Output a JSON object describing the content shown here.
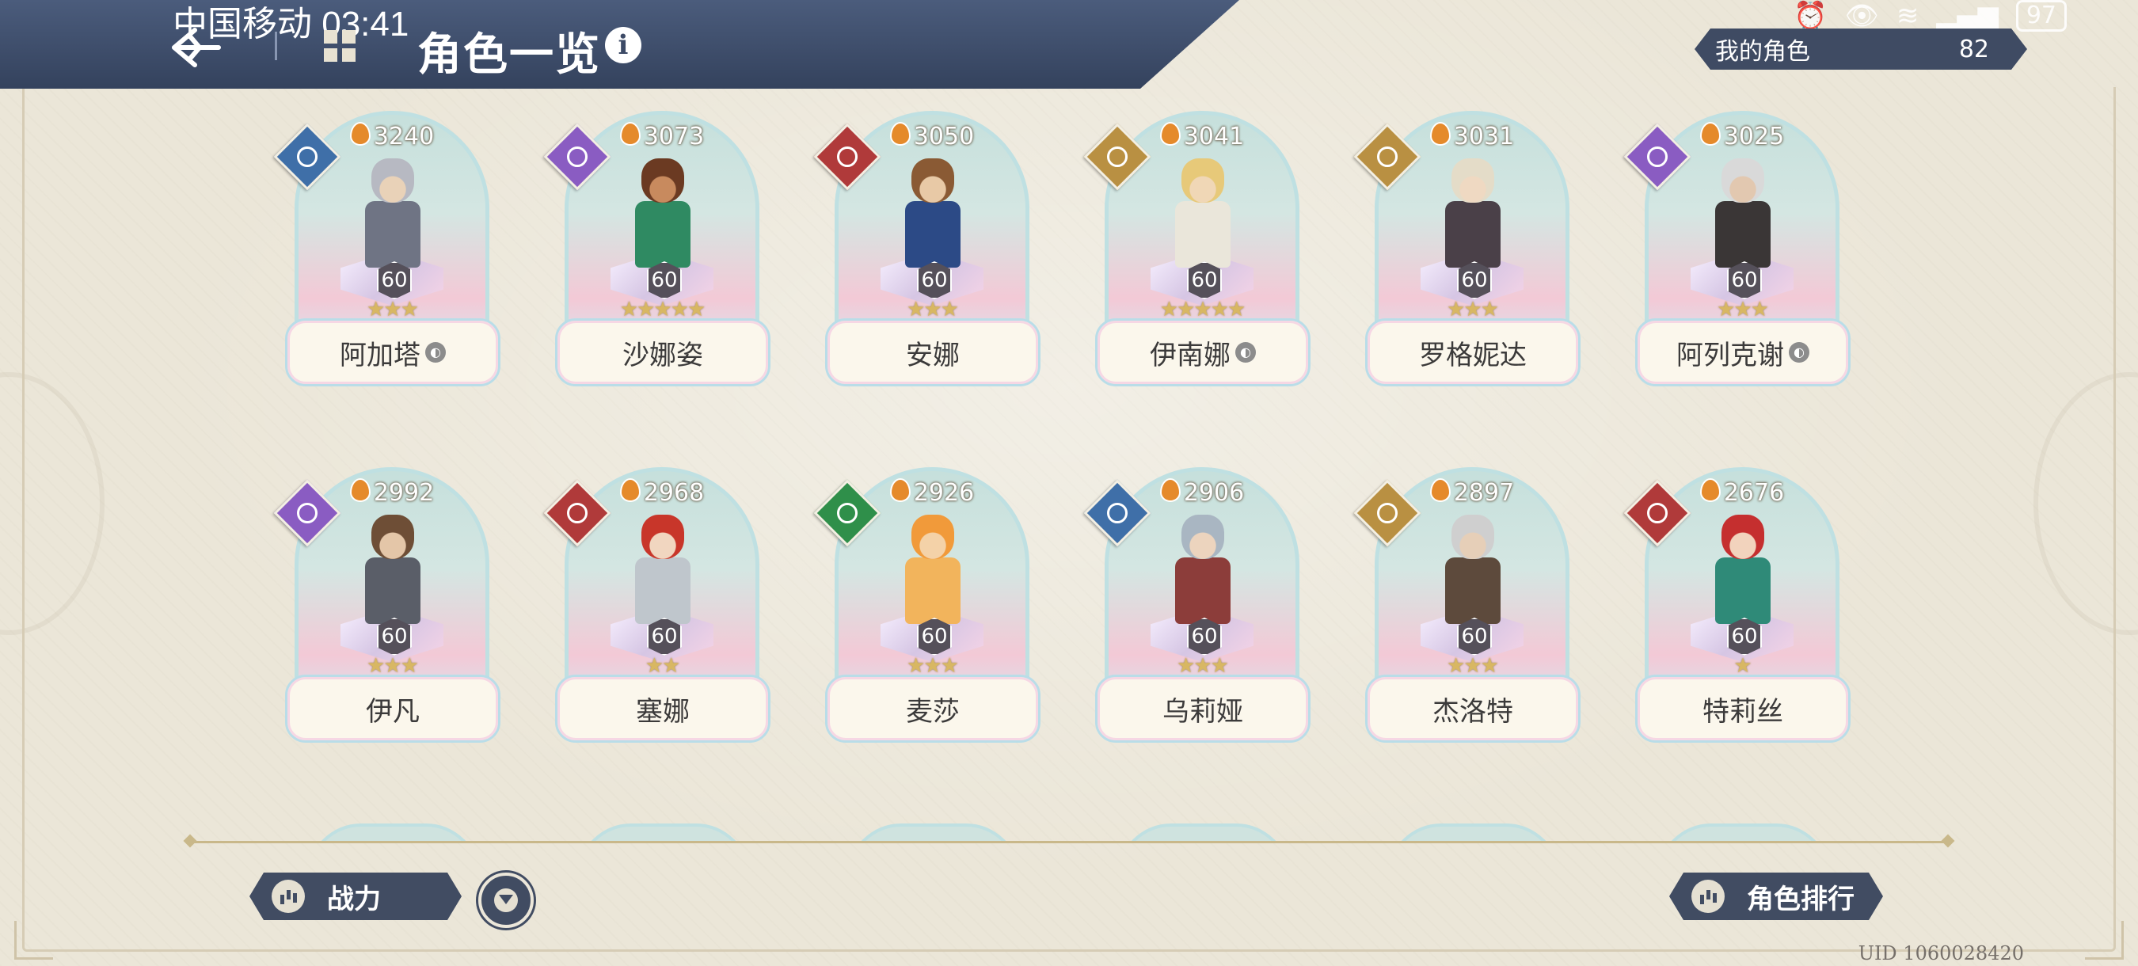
{
  "status_bar": {
    "carrier_time": "中国移动 03:41",
    "battery": "97"
  },
  "header": {
    "title": "角色一览",
    "info_label": "i"
  },
  "my_characters": {
    "label": "我的角色",
    "count": "82"
  },
  "characters": [
    {
      "name": "阿加塔",
      "power": "3240",
      "level": "60",
      "stars": 3,
      "class_color": "#3f6fa8",
      "collab": true
    },
    {
      "name": "沙娜姿",
      "power": "3073",
      "level": "60",
      "stars": 5,
      "class_color": "#8a5cc2",
      "collab": false
    },
    {
      "name": "安娜",
      "power": "3050",
      "level": "60",
      "stars": 3,
      "class_color": "#b03a3a",
      "collab": false
    },
    {
      "name": "伊南娜",
      "power": "3041",
      "level": "60",
      "stars": 5,
      "class_color": "#b99042",
      "collab": true
    },
    {
      "name": "罗格妮达",
      "power": "3031",
      "level": "60",
      "stars": 3,
      "class_color": "#b99042",
      "collab": false
    },
    {
      "name": "阿列克谢",
      "power": "3025",
      "level": "60",
      "stars": 3,
      "class_color": "#8a5cc2",
      "collab": true
    },
    {
      "name": "伊凡",
      "power": "2992",
      "level": "60",
      "stars": 3,
      "class_color": "#8a5cc2",
      "collab": false
    },
    {
      "name": "塞娜",
      "power": "2968",
      "level": "60",
      "stars": 2,
      "class_color": "#b03a3a",
      "collab": false
    },
    {
      "name": "麦莎",
      "power": "2926",
      "level": "60",
      "stars": 3,
      "class_color": "#2f8f4a",
      "collab": false
    },
    {
      "name": "乌莉娅",
      "power": "2906",
      "level": "60",
      "stars": 3,
      "class_color": "#3f6fa8",
      "collab": false
    },
    {
      "name": "杰洛特",
      "power": "2897",
      "level": "60",
      "stars": 3,
      "class_color": "#b99042",
      "collab": false
    },
    {
      "name": "特莉丝",
      "power": "2676",
      "level": "60",
      "stars": 1,
      "class_color": "#b03a3a",
      "collab": false
    }
  ],
  "footer": {
    "sort_label": "战力",
    "ranking_label": "角色排行",
    "uid": "UID 1060028420"
  }
}
